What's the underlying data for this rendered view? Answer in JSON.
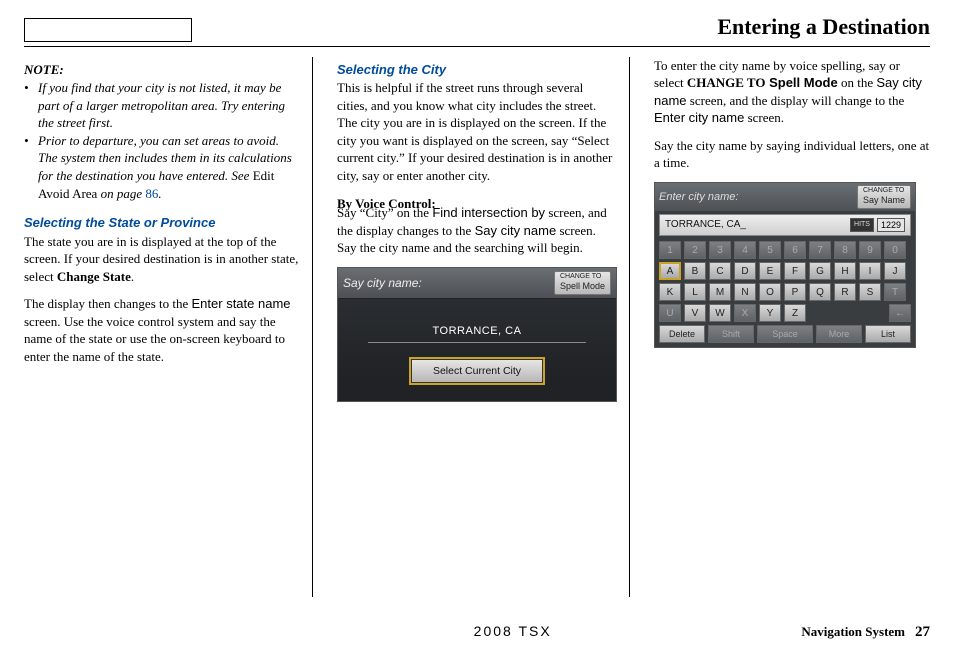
{
  "header": {
    "title": "Entering a Destination"
  },
  "col1": {
    "note_label": "NOTE:",
    "note_items": [
      {
        "text": "If you find that your city is not listed, it may be part of a larger metropolitan area. Try entering the street first."
      },
      {
        "text_a": "Prior to departure, you can set areas to avoid. The system then includes them in its calculations for the destination you have entered. See ",
        "text_b": "Edit Avoid Area",
        "text_c": " on page ",
        "page_ref": "86",
        "text_d": "."
      }
    ],
    "head1": "Selecting the State or Province",
    "para1_a": "The state you are in is displayed at the top of the screen. If your desired destination is in another state, select ",
    "para1_b": "Change State",
    "para1_c": ".",
    "para2_a": "The display then changes to the ",
    "para2_b": "Enter state name",
    "para2_c": " screen. Use the voice control system and say the name of the state or use the on-screen keyboard to enter the name of the state."
  },
  "col2": {
    "head1": "Selecting the City",
    "para1": "This is helpful if the street runs through several cities, and you know what city includes the street. The city you are in is displayed on the screen. If the city you want is displayed on the screen, say “Select current city.” If your desired destination is in another city, say or enter another city.",
    "subhead": "By Voice Control:",
    "para2_a": "Say “City” on the ",
    "para2_b": "Find intersection by",
    "para2_c": " screen, and the display changes to the ",
    "para2_d": "Say city name",
    "para2_e": " screen. Say the city name and the searching will begin.",
    "screen": {
      "title": "Say city name:",
      "chip_small": "CHANGE TO",
      "chip_label": "Spell Mode",
      "city": "TORRANCE, CA",
      "button": "Select Current City"
    }
  },
  "col3": {
    "para1_a": "To enter the city name by voice spelling, say or select ",
    "para1_b": "CHANGE TO",
    "para1_c": " Spell Mode",
    "para1_d": " on the ",
    "para1_e": "Say city name",
    "para1_f": " screen, and the display will change to the ",
    "para1_g": "Enter city name",
    "para1_h": " screen.",
    "para2": "Say the city name by saying individual letters, one at a time.",
    "screen": {
      "title": "Enter city name:",
      "chip_small": "CHANGE TO",
      "chip_label": "Say Name",
      "entry": "TORRANCE, CA_",
      "hits_label": "HITS",
      "hits_count": "1229",
      "row_nums": [
        "1",
        "2",
        "3",
        "4",
        "5",
        "6",
        "7",
        "8",
        "9",
        "0"
      ],
      "row_a": [
        "A",
        "B",
        "C",
        "D",
        "E",
        "F",
        "G",
        "H",
        "I",
        "J"
      ],
      "row_k": [
        "K",
        "L",
        "M",
        "N",
        "O",
        "P",
        "Q",
        "R",
        "S",
        "T"
      ],
      "row_u": [
        "U",
        "V",
        "W",
        "X",
        "Y",
        "Z"
      ],
      "bottom": {
        "del": "Delete",
        "shift": "Shift",
        "space": "Space",
        "more": "More",
        "list": "List"
      }
    }
  },
  "footer": {
    "car": "2008  TSX",
    "sys": "Navigation System",
    "page": "27"
  }
}
